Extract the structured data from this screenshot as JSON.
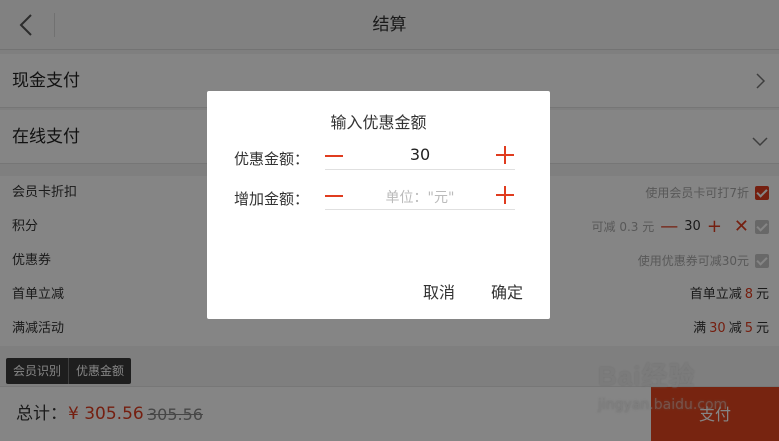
{
  "header": {
    "title": "结算"
  },
  "rows": {
    "cash": {
      "label": "现金支付"
    },
    "online": {
      "label": "在线支付"
    }
  },
  "options": {
    "member_card": {
      "label": "会员卡折扣",
      "hint": "使用会员卡可打7折",
      "checked": true
    },
    "points": {
      "label": "积分",
      "hint": "可减 0.3 元",
      "value": "30"
    },
    "coupon": {
      "label": "优惠券",
      "hint": "使用优惠券可减30元",
      "checked": false
    },
    "first_order": {
      "label": "首单立减",
      "prefix": "首单立减",
      "amount": "8",
      "unit": "元"
    },
    "full_reduction": {
      "label": "满减活动",
      "w1": "满",
      "threshold": "30",
      "w2": "减",
      "amount": "5",
      "unit": "元"
    }
  },
  "tags": [
    "会员识别",
    "优惠金额"
  ],
  "footer": {
    "total_label": "总计：",
    "total_amount": "¥ 305.56",
    "original_amount": "305.56",
    "pay_label": "支付"
  },
  "watermark": {
    "line1": "Bai经验",
    "line2": "jingyan.baidu.com"
  },
  "dialog": {
    "title": "输入优惠金额",
    "discount": {
      "label": "优惠金额：",
      "value": "30"
    },
    "extra": {
      "label": "增加金额：",
      "placeholder": "单位：\"元\""
    },
    "cancel": "取消",
    "confirm": "确定"
  },
  "colors": {
    "accent": "#e03c1f",
    "pay_button": "#e5461f"
  }
}
